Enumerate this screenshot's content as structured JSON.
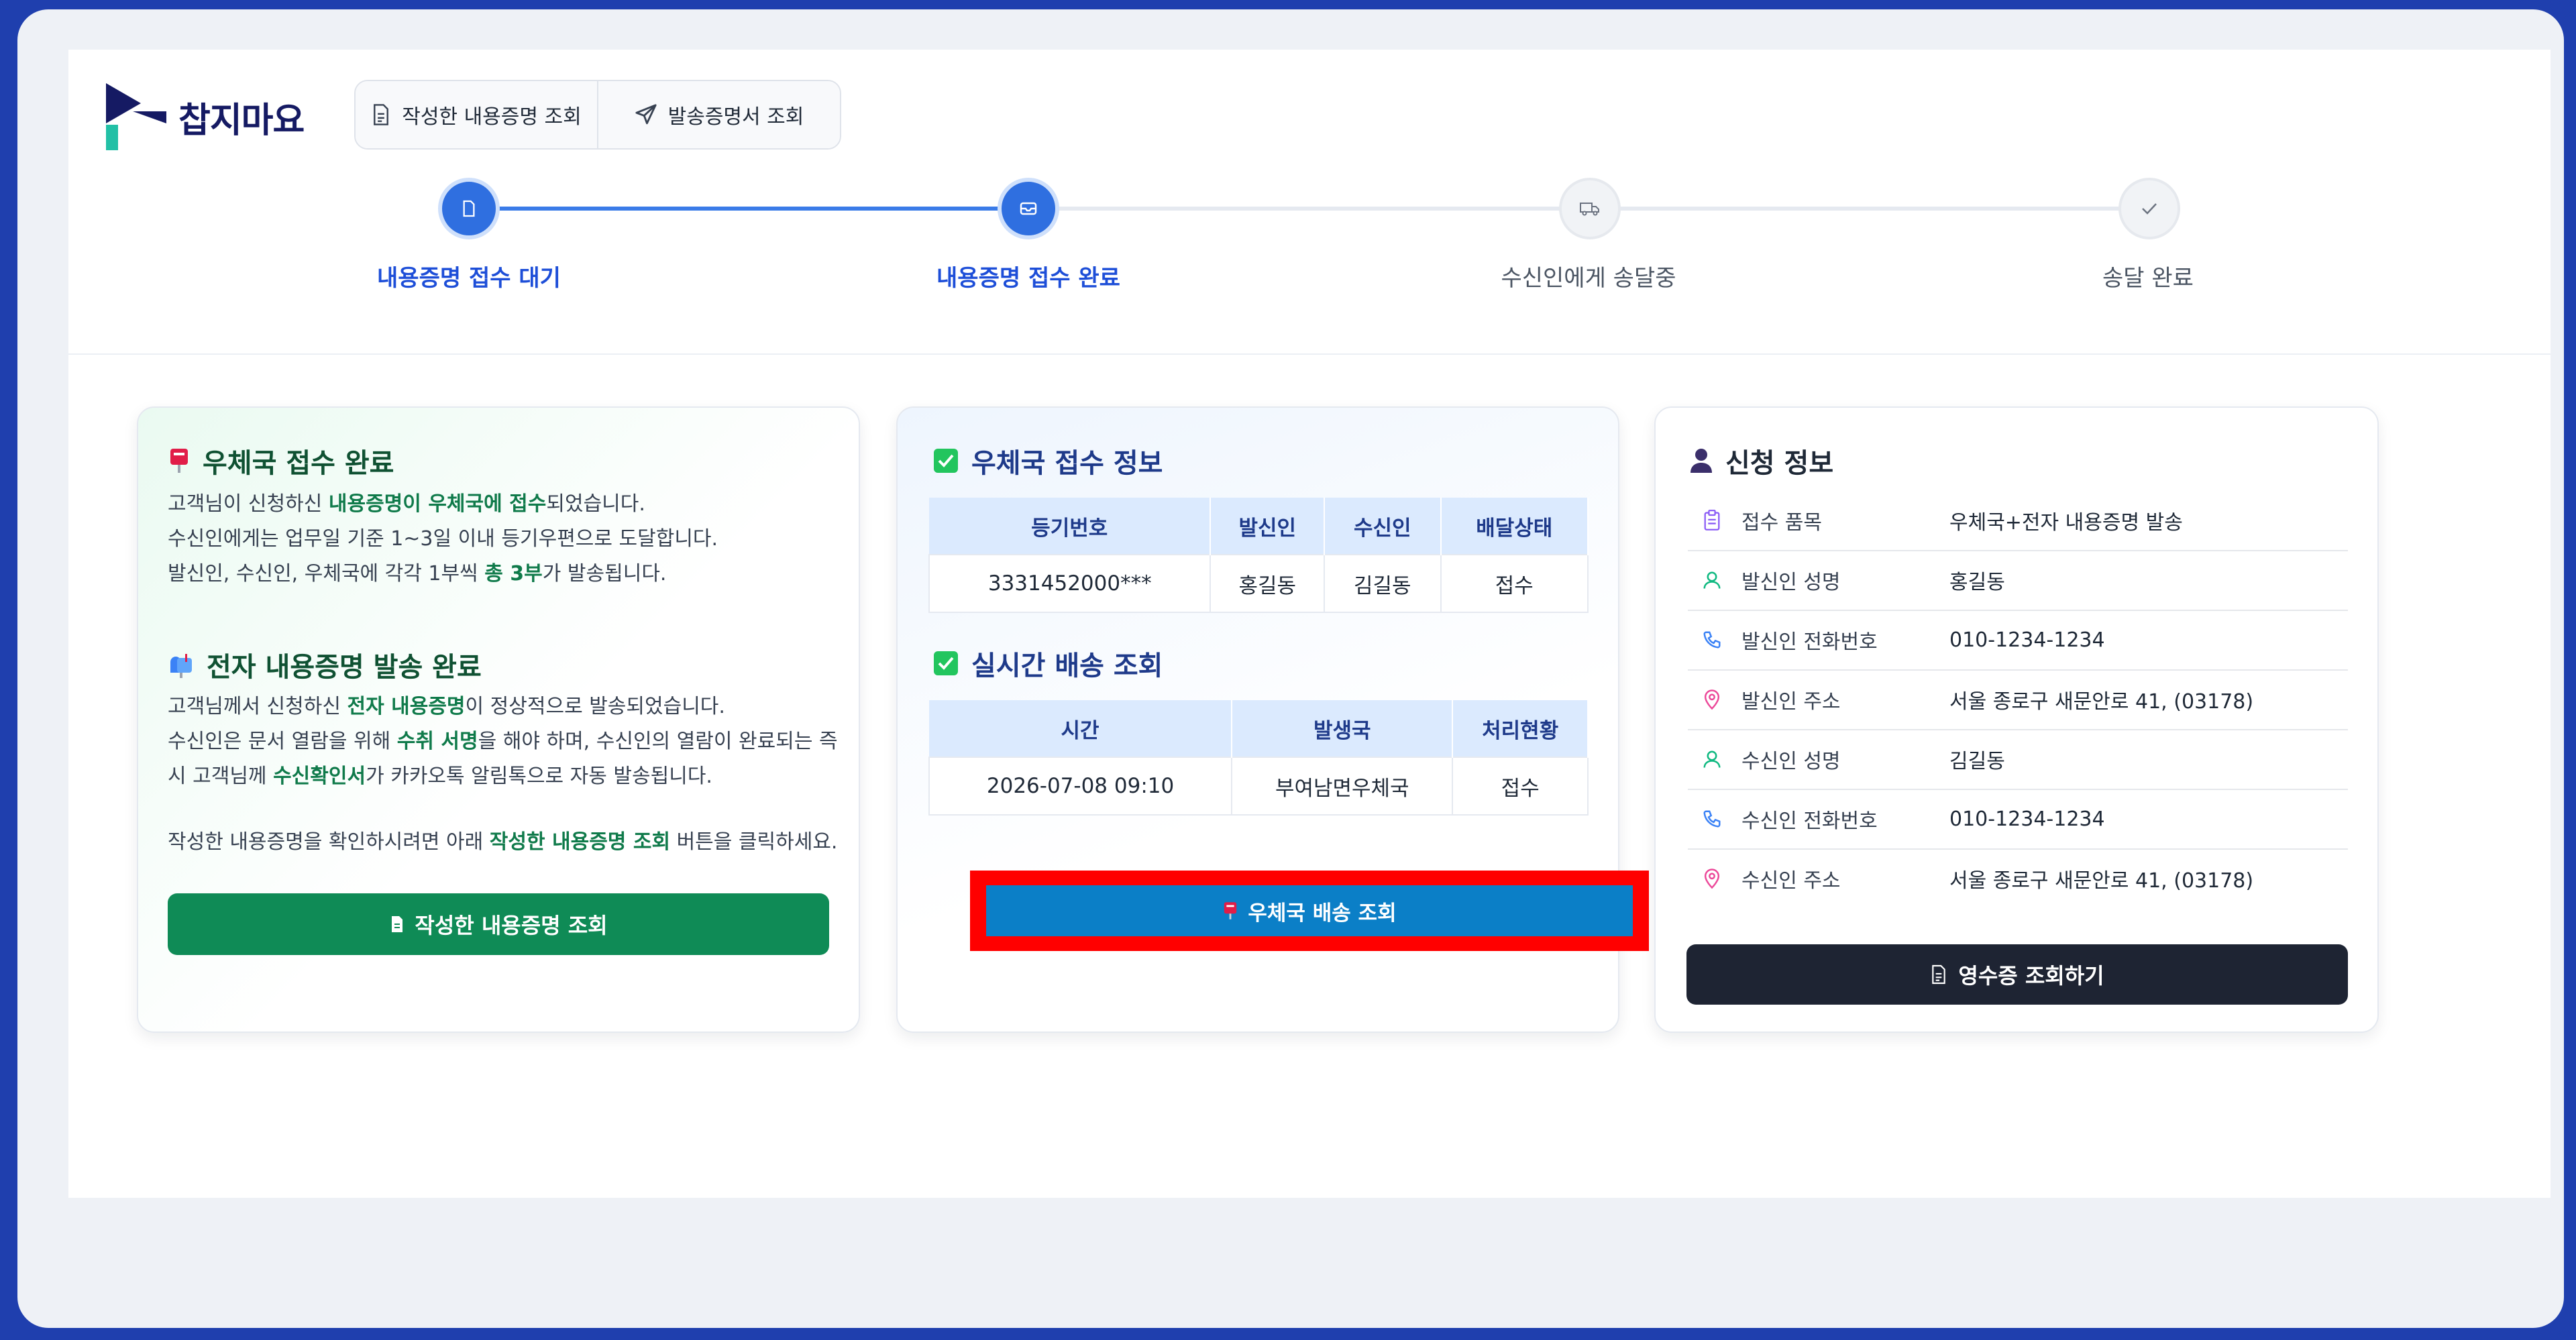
{
  "brand": {
    "name": "찹지마요"
  },
  "toolbar": {
    "written_label": "작성한 내용증명 조회",
    "sent_label": "발송증명서 조회"
  },
  "steps": [
    {
      "label": "내용증명 접수 대기",
      "state": "done"
    },
    {
      "label": "내용증명 접수 완료",
      "state": "current"
    },
    {
      "label": "수신인에게 송달중",
      "state": "pending"
    },
    {
      "label": "송달 완료",
      "state": "pending"
    }
  ],
  "left_panel": {
    "post_title": "우체국 접수 완료",
    "post_line1_a": "고객님이 신청하신 ",
    "post_line1_hl": "내용증명이 우체국에 접수",
    "post_line1_b": "되었습니다.",
    "post_line2": "수신인에게는 업무일 기준 1~3일 이내 등기우편으로 도달합니다.",
    "post_line3_a": "발신인, 수신인, 우체국에 각각 1부씩 ",
    "post_line3_hl": "총 3부",
    "post_line3_b": "가 발송됩니다.",
    "e_title": "전자 내용증명 발송 완료",
    "e_line1_a": "고객님께서 신청하신 ",
    "e_line1_hl": "전자 내용증명",
    "e_line1_b": "이 정상적으로 발송되었습니다.",
    "e_line2_a": "수신인은 문서 열람을 위해 ",
    "e_line2_hl": "수취 서명",
    "e_line2_b": "을 해야 하며, 수신인의 열람이 완료되는 즉",
    "e_line3_a": "시 고객님께 ",
    "e_line3_hl": "수신확인서",
    "e_line3_b": "가 카카오톡 알림톡으로 자동 발송됩니다.",
    "hint_a": "작성한 내용증명을 확인하시려면 아래 ",
    "hint_hl": "작성한 내용증명 조회",
    "hint_b": " 버튼을 클릭하세요.",
    "button_label": "작성한 내용증명 조회"
  },
  "mid_panel": {
    "receipt_title": "우체국 접수 정보",
    "receipt_headers": [
      "등기번호",
      "발신인",
      "수신인",
      "배달상태"
    ],
    "receipt_row": [
      "3331452000***",
      "홍길동",
      "김길동",
      "접수"
    ],
    "tracking_title": "실시간 배송 조회",
    "tracking_headers": [
      "시간",
      "발생국",
      "처리현황"
    ],
    "tracking_row": [
      "2026-07-08 09:10",
      "부여남면우체국",
      "접수"
    ],
    "delivery_button": "우체국 배송 조회"
  },
  "right_panel": {
    "title": "신청 정보",
    "rows": [
      {
        "icon": "clipboard-icon",
        "label": "접수 품목",
        "value": "우체국+전자 내용증명 발송"
      },
      {
        "icon": "user-icon",
        "label": "발신인 성명",
        "value": "홍길동"
      },
      {
        "icon": "phone-icon",
        "label": "발신인 전화번호",
        "value": "010-1234-1234"
      },
      {
        "icon": "location-pin-icon",
        "label": "발신인 주소",
        "value": "서울 종로구 새문안로 41, (03178)"
      },
      {
        "icon": "user-icon",
        "label": "수신인 성명",
        "value": "김길동"
      },
      {
        "icon": "phone-icon",
        "label": "수신인 전화번호",
        "value": "010-1234-1234"
      },
      {
        "icon": "location-pin-icon",
        "label": "수신인 주소",
        "value": "서울 종로구 새문안로 41, (03178)"
      }
    ],
    "button_label": "영수증 조회하기"
  },
  "colors": {
    "accent_blue": "#2f6fe0",
    "green": "#0f8b56",
    "delivery_blue": "#0b7fc7",
    "highlight_red": "#ff0000",
    "dark": "#1e2433"
  }
}
